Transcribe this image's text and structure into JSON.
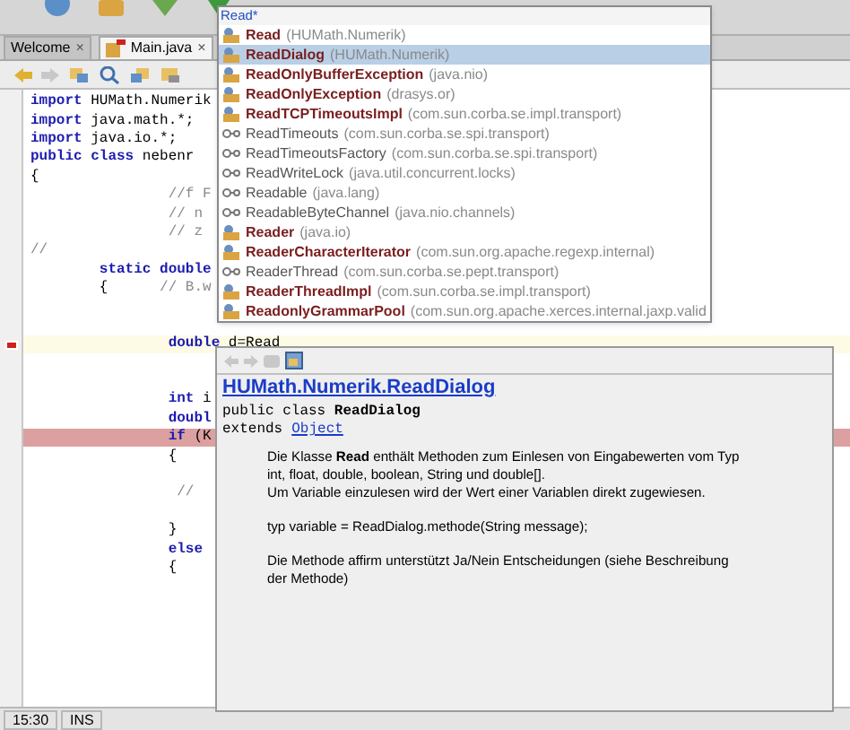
{
  "tabs": [
    {
      "label": "Welcome",
      "close": "×",
      "selected": false
    },
    {
      "label": "Main.java",
      "close": "×",
      "selected": true
    }
  ],
  "editor": {
    "lines": [
      {
        "segments": [
          {
            "kind": "keyword",
            "text": "import"
          },
          {
            "kind": "plain",
            "text": " HUMath.Numerik"
          }
        ]
      },
      {
        "segments": [
          {
            "kind": "keyword",
            "text": "import"
          },
          {
            "kind": "plain",
            "text": " java.math.*;"
          }
        ]
      },
      {
        "segments": [
          {
            "kind": "keyword",
            "text": "import"
          },
          {
            "kind": "plain",
            "text": " java.io.*;"
          }
        ]
      },
      {
        "segments": [
          {
            "kind": "keyword",
            "text": "public class"
          },
          {
            "kind": "plain",
            "text": " nebenr"
          }
        ]
      },
      {
        "segments": [
          {
            "kind": "plain",
            "text": "{"
          }
        ]
      },
      {
        "segments": [
          {
            "kind": "comment",
            "text": "                //f F"
          }
        ]
      },
      {
        "segments": [
          {
            "kind": "comment",
            "text": "                // n"
          }
        ]
      },
      {
        "segments": [
          {
            "kind": "comment",
            "text": "                // z"
          }
        ]
      },
      {
        "segments": [
          {
            "kind": "comment",
            "text": "//"
          }
        ]
      },
      {
        "segments": [
          {
            "kind": "keyword",
            "text": "        static double"
          }
        ]
      },
      {
        "segments": [
          {
            "kind": "plain",
            "text": "        {      "
          },
          {
            "kind": "comment",
            "text": "// B.w"
          }
        ]
      },
      {
        "kind": "blank"
      },
      {
        "kind": "blank"
      },
      {
        "current": true,
        "error": true,
        "segments": [
          {
            "kind": "keyword",
            "text": "                double"
          },
          {
            "kind": "plain",
            "text": " d=Read"
          }
        ]
      },
      {
        "kind": "blank"
      },
      {
        "kind": "blank"
      },
      {
        "segments": [
          {
            "kind": "keyword",
            "text": "                int"
          },
          {
            "kind": "plain",
            "text": " i"
          }
        ]
      },
      {
        "segments": [
          {
            "kind": "keyword",
            "text": "                doubl"
          }
        ]
      },
      {
        "breakpoint": true,
        "segments": [
          {
            "kind": "keyword",
            "text": "                if"
          },
          {
            "kind": "plain",
            "text": " (K"
          }
        ]
      },
      {
        "segments": [
          {
            "kind": "plain",
            "text": "                {"
          }
        ]
      },
      {
        "kind": "blank"
      },
      {
        "segments": [
          {
            "kind": "comment",
            "text": "                 //"
          }
        ]
      },
      {
        "kind": "blank"
      },
      {
        "segments": [
          {
            "kind": "plain",
            "text": "                }"
          }
        ]
      },
      {
        "segments": [
          {
            "kind": "keyword",
            "text": "                else"
          }
        ]
      },
      {
        "segments": [
          {
            "kind": "plain",
            "text": "                {"
          }
        ]
      }
    ]
  },
  "status_bar": {
    "position": "15:30",
    "mode": "INS"
  },
  "completion": {
    "query": "Read*",
    "items": [
      {
        "kind": "class",
        "name": "Read",
        "package": "(HUMath.Numerik)",
        "selected": false
      },
      {
        "kind": "class",
        "name": "ReadDialog",
        "package": "(HUMath.Numerik)",
        "selected": true
      },
      {
        "kind": "class",
        "name": "ReadOnlyBufferException",
        "package": "(java.nio)",
        "selected": false
      },
      {
        "kind": "class",
        "name": "ReadOnlyException",
        "package": "(drasys.or)",
        "selected": false
      },
      {
        "kind": "class",
        "name": "ReadTCPTimeoutsImpl",
        "package": "(com.sun.corba.se.impl.transport)",
        "selected": false
      },
      {
        "kind": "interface",
        "name": "ReadTimeouts",
        "package": "(com.sun.corba.se.spi.transport)",
        "selected": false
      },
      {
        "kind": "interface",
        "name": "ReadTimeoutsFactory",
        "package": "(com.sun.corba.se.spi.transport)",
        "selected": false
      },
      {
        "kind": "interface",
        "name": "ReadWriteLock",
        "package": "(java.util.concurrent.locks)",
        "selected": false
      },
      {
        "kind": "interface",
        "name": "Readable",
        "package": "(java.lang)",
        "selected": false
      },
      {
        "kind": "interface",
        "name": "ReadableByteChannel",
        "package": "(java.nio.channels)",
        "selected": false
      },
      {
        "kind": "class",
        "name": "Reader",
        "package": "(java.io)",
        "selected": false
      },
      {
        "kind": "class",
        "name": "ReaderCharacterIterator",
        "package": "(com.sun.org.apache.regexp.internal)",
        "selected": false
      },
      {
        "kind": "interface",
        "name": "ReaderThread",
        "package": "(com.sun.corba.se.pept.transport)",
        "selected": false
      },
      {
        "kind": "class",
        "name": "ReaderThreadImpl",
        "package": "(com.sun.corba.se.impl.transport)",
        "selected": false
      },
      {
        "kind": "class",
        "name": "ReadonlyGrammarPool",
        "package": "(com.sun.org.apache.xerces.internal.jaxp.valid",
        "selected": false
      }
    ]
  },
  "javadoc": {
    "title": "HUMath.Numerik.ReadDialog",
    "declaration": "public class **ReadDialog**",
    "extends_keyword": "extends",
    "extends_link": "Object",
    "paragraphs": [
      "Die Klasse **Read** enthält Methoden zum Einlesen von Eingabewerten vom Typ\nint, float, double, boolean, String und double[].\nUm Variable einzulesen wird der Wert einer Variablen direkt zugewiesen.",
      "typ variable = ReadDialog.methode(String message);",
      "Die Methode affirm unterstützt Ja/Nein Entscheidungen (siehe Beschreibung\nder Methode)"
    ]
  }
}
